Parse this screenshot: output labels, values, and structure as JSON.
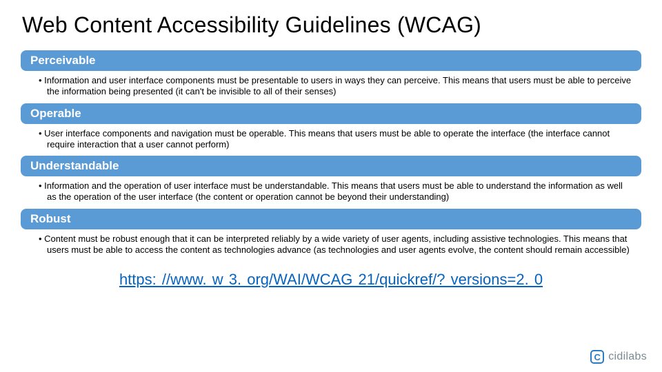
{
  "title": "Web Content Accessibility Guidelines (WCAG)",
  "principles": [
    {
      "name": "Perceivable",
      "desc": "Information and user interface components must be presentable to users in ways they can perceive. This means that users must be able to perceive the information being presented (it can't be invisible to all of their senses)"
    },
    {
      "name": "Operable",
      "desc": "User interface components and navigation must be operable. This means that users must be able to operate the interface (the interface cannot require interaction that a user cannot perform)"
    },
    {
      "name": "Understandable",
      "desc": "Information and the operation of user interface must be understandable. This means that users must be able to understand the information as well as the operation of the user interface (the content or operation cannot be beyond their understanding)"
    },
    {
      "name": "Robust",
      "desc": "Content must be robust enough that it can be interpreted reliably by a wide variety of user agents, including assistive technologies. This means that users must be able to access the content as technologies advance (as technologies and user agents evolve, the content should remain accessible)"
    }
  ],
  "link_text": "https: //www. w 3. org/WAI/WCAG 21/quickref/? versions=2. 0",
  "logo": {
    "mark": "C",
    "text": "cidilabs"
  }
}
